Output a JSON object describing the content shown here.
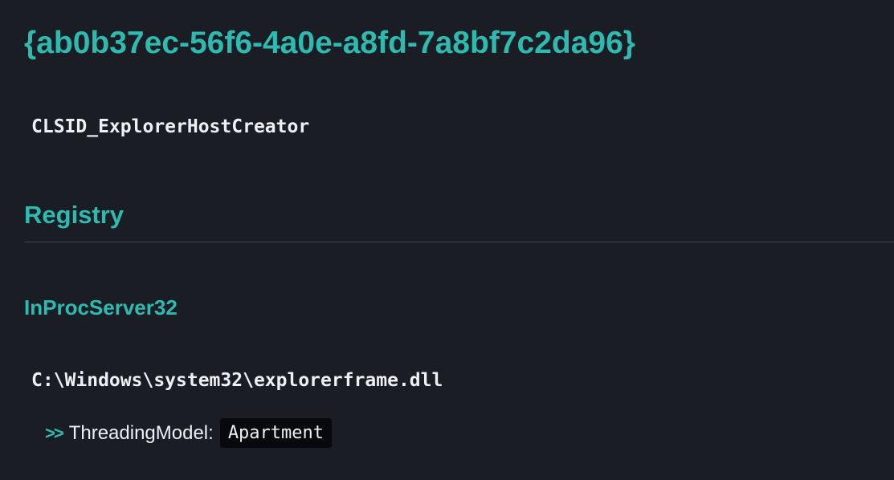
{
  "clsid": "{ab0b37ec-56f6-4a0e-a8fd-7a8bf7c2da96}",
  "name": "CLSID_ExplorerHostCreator",
  "registry": {
    "heading": "Registry",
    "inproc": {
      "heading": "InProcServer32",
      "path": "C:\\Windows\\system32\\explorerframe.dll",
      "property": {
        "arrow": ">>",
        "label": "ThreadingModel:",
        "value": "Apartment"
      }
    }
  },
  "colors": {
    "background": "#1b1d24",
    "accent": "#2ebab0",
    "text": "#eef0f4",
    "divider": "#3e424d",
    "code_background": "#08090c"
  },
  "icons": {
    "property_arrow": "double-chevron-right-icon"
  }
}
